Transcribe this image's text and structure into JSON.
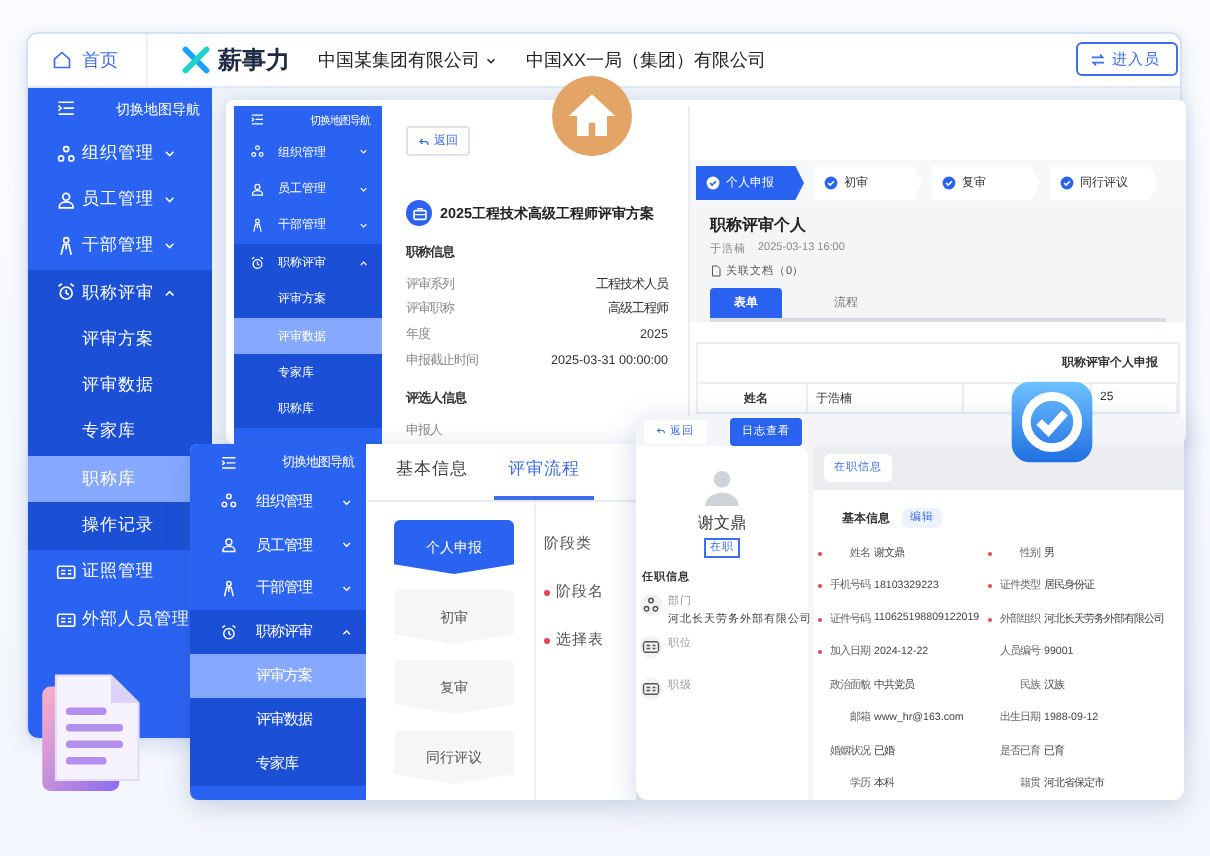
{
  "topbar": {
    "home": "首页",
    "brand": "薪事力",
    "org_select": "中国某集团有限公司",
    "org": "中国XX一局（集团）有限公司",
    "enter_button": "进入员"
  },
  "main_nav": {
    "header": "切换地图导航",
    "items": [
      {
        "label": "组织管理",
        "expanded": false
      },
      {
        "label": "员工管理",
        "expanded": false
      },
      {
        "label": "干部管理",
        "expanded": false
      },
      {
        "label": "职称评审",
        "expanded": true,
        "children": [
          {
            "label": "评审方案",
            "selected": false
          },
          {
            "label": "评审数据",
            "selected": false
          },
          {
            "label": "专家库",
            "selected": false
          },
          {
            "label": "职称库",
            "selected": true
          },
          {
            "label": "操作记录",
            "selected": false
          }
        ]
      },
      {
        "label": "证照管理"
      },
      {
        "label": "外部人员管理"
      }
    ]
  },
  "plan_window": {
    "nav": {
      "header": "切换地图导航",
      "items": [
        {
          "label": "组织管理",
          "expanded": false
        },
        {
          "label": "员工管理",
          "expanded": false
        },
        {
          "label": "干部管理",
          "expanded": false
        },
        {
          "label": "职称评审",
          "expanded": true,
          "children": [
            {
              "label": "评审方案",
              "selected": false
            },
            {
              "label": "评审数据",
              "selected": true
            },
            {
              "label": "专家库",
              "selected": false
            },
            {
              "label": "职称库",
              "selected": false
            }
          ]
        }
      ]
    },
    "back": "返回",
    "title": "2025工程技术高级工程师评审方案",
    "section_1": "职称信息",
    "info": [
      {
        "label": "评审系列",
        "value": "工程技术人员"
      },
      {
        "label": "评审职称",
        "value": "高级工程师"
      },
      {
        "label": "年度",
        "value": "2025"
      },
      {
        "label": "申报截止时间",
        "value": "2025-03-31 00:00:00"
      }
    ],
    "section_2": "评选人信息",
    "applicant_label": "申报人",
    "steps": [
      {
        "label": "个人申报",
        "selected": true
      },
      {
        "label": "初审",
        "selected": false
      },
      {
        "label": "复审",
        "selected": false
      },
      {
        "label": "同行评议",
        "selected": false
      }
    ],
    "form_title": "职称评审个人",
    "author": "于浩楠",
    "time": "2025-03-13 16:00",
    "attachments": "关联文档（0）",
    "tabs": [
      {
        "label": "表单",
        "selected": true
      },
      {
        "label": "流程",
        "selected": false
      }
    ],
    "table": {
      "title": "职称评审个人申报",
      "row": [
        "姓名",
        "于浩楠",
        "25"
      ]
    }
  },
  "flow_window": {
    "nav": {
      "header": "切换地图导航",
      "items": [
        {
          "label": "组织管理",
          "expanded": false
        },
        {
          "label": "员工管理",
          "expanded": false
        },
        {
          "label": "干部管理",
          "expanded": false
        },
        {
          "label": "职称评审",
          "expanded": true,
          "children": [
            {
              "label": "评审方案",
              "selected": true
            },
            {
              "label": "评审数据",
              "selected": false
            },
            {
              "label": "专家库",
              "selected": false
            }
          ]
        }
      ]
    },
    "tabs": [
      {
        "label": "基本信息",
        "selected": false
      },
      {
        "label": "评审流程",
        "selected": true
      }
    ],
    "stages": [
      {
        "label": "个人申报",
        "selected": true
      },
      {
        "label": "初审",
        "selected": false
      },
      {
        "label": "复审",
        "selected": false
      },
      {
        "label": "同行评议",
        "selected": false
      }
    ],
    "fields": [
      {
        "label": "阶段类",
        "required": false
      },
      {
        "label": "阶段名",
        "required": true
      },
      {
        "label": "选择表",
        "required": true
      }
    ]
  },
  "profile_window": {
    "back": "返回",
    "log_button": "日志查看",
    "name": "谢文鼎",
    "status": "在职",
    "job_section": "任职信息",
    "job_items": [
      {
        "label": "部门",
        "value": "河北长天劳务外部有限公司"
      },
      {
        "label": "职位"
      },
      {
        "label": "职级"
      }
    ],
    "tab": "在职信息",
    "section": "基本信息",
    "edit": "编辑",
    "fields": [
      {
        "label": "姓名",
        "value": "谢文鼎",
        "required": true
      },
      {
        "label": "性别",
        "value": "男",
        "required": true
      },
      {
        "label": "手机号码",
        "value": "18103329223",
        "required": true
      },
      {
        "label": "证件类型",
        "value": "居民身份证",
        "required": true
      },
      {
        "label": "证件号码",
        "value": "110625198809122019",
        "required": true
      },
      {
        "label": "外部组织",
        "value": "河北长天劳务外部有限公司",
        "required": true
      },
      {
        "label": "加入日期",
        "value": "2024-12-22",
        "required": true
      },
      {
        "label": "人员编号",
        "value": "99001",
        "required": false
      },
      {
        "label": "政治面貌",
        "value": "中共党员",
        "required": false
      },
      {
        "label": "民族",
        "value": "汉族",
        "required": false
      },
      {
        "label": "邮箱",
        "value": "www_hr@163.com",
        "required": false
      },
      {
        "label": "出生日期",
        "value": "1988-09-12",
        "required": false
      },
      {
        "label": "婚姻状况",
        "value": "已婚",
        "required": false
      },
      {
        "label": "是否已育",
        "value": "已育",
        "required": false
      },
      {
        "label": "学历",
        "value": "本科",
        "required": false
      },
      {
        "label": "籍贯",
        "value": "河北省保定市",
        "required": false
      }
    ]
  }
}
